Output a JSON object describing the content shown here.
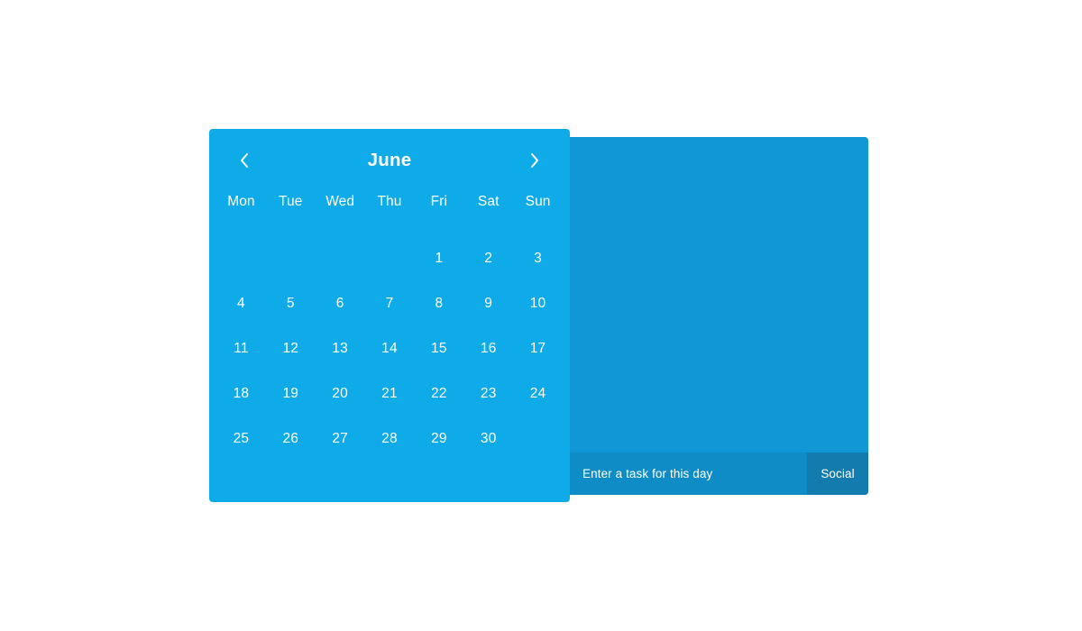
{
  "theme": {
    "calendar_bg": "#0FAAE8",
    "task_panel_bg": "#1196D6",
    "task_entry_bg": "#0E8CC6",
    "task_category_bg": "#147BAE",
    "text_color": "#FFFFFF",
    "page_bg": "#FFFFFF"
  },
  "calendar": {
    "title": "June",
    "prev_label": "‹",
    "next_label": "›",
    "weekdays": [
      "Mon",
      "Tue",
      "Wed",
      "Thu",
      "Fri",
      "Sat",
      "Sun"
    ],
    "leading_blanks": 4,
    "days": [
      "1",
      "2",
      "3",
      "4",
      "5",
      "6",
      "7",
      "8",
      "9",
      "10",
      "11",
      "12",
      "13",
      "14",
      "15",
      "16",
      "17",
      "18",
      "19",
      "20",
      "21",
      "22",
      "23",
      "24",
      "25",
      "26",
      "27",
      "28",
      "29",
      "30"
    ],
    "trailing_blanks": 1
  },
  "task_panel": {
    "input_value": "",
    "input_placeholder": "Enter a task for this day",
    "category_label": "Social"
  }
}
